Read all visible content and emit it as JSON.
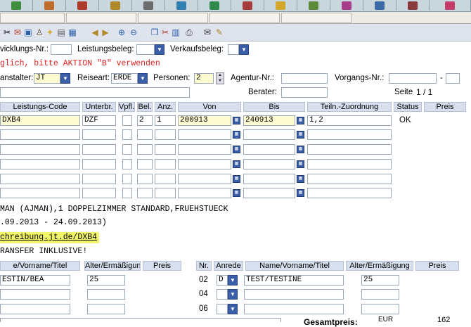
{
  "toolbar": {
    "icons": [
      "printer-icon",
      "mail-icon",
      "save-icon",
      "user-icon",
      "lightbulb-icon",
      "calculator-icon",
      "arrow-left-icon",
      "arrow-right-icon",
      "zoom-in-icon",
      "zoom-out-icon",
      "copy-icon",
      "cut-icon",
      "paste-icon",
      "print-icon",
      "envelope-icon",
      "pen-icon"
    ]
  },
  "form": {
    "abwicklung_label": "vicklungs-Nr.:",
    "leistungsbeleg_label": "Leistungsbeleg:",
    "verkaufsbeleg_label": "Verkaufsbeleg:",
    "message": "glich, bitte AKTION \"B\" verwenden",
    "veranstalter_label": "anstalter:",
    "veranstalter_value": "JT",
    "reiseart_label": "Reiseart:",
    "reiseart_value": "ERDE",
    "personen_label": "Personen:",
    "personen_value": "2",
    "agentur_label": "Agentur-Nr.:",
    "vorgangs_label": "Vorgangs-Nr.:",
    "vorgangs_dash": "-",
    "berater_label": "Berater:",
    "seite_label": "Seite",
    "seite_value": "1 / 1"
  },
  "grid": {
    "headers": [
      "Leistungs-Code",
      "Unterbr.",
      "Vpfl.",
      "Bel.",
      "Anz.",
      "Von",
      "Bis",
      "Teiln.-Zuordnung",
      "Status",
      "Preis"
    ],
    "rows": [
      {
        "code": "DXB4",
        "unterbr": "DZF",
        "vpfl": "",
        "bel": "2",
        "anz": "1",
        "von": "200913",
        "bis": "240913",
        "teiln": "1,2",
        "status": "OK"
      },
      {
        "code": "",
        "unterbr": "",
        "vpfl": "",
        "bel": "",
        "anz": "",
        "von": "",
        "bis": "",
        "teiln": "",
        "status": ""
      },
      {
        "code": "",
        "unterbr": "",
        "vpfl": "",
        "bel": "",
        "anz": "",
        "von": "",
        "bis": "",
        "teiln": "",
        "status": ""
      },
      {
        "code": "",
        "unterbr": "",
        "vpfl": "",
        "bel": "",
        "anz": "",
        "von": "",
        "bis": "",
        "teiln": "",
        "status": ""
      },
      {
        "code": "",
        "unterbr": "",
        "vpfl": "",
        "bel": "",
        "anz": "",
        "von": "",
        "bis": "",
        "teiln": "",
        "status": ""
      },
      {
        "code": "",
        "unterbr": "",
        "vpfl": "",
        "bel": "",
        "anz": "",
        "von": "",
        "bis": "",
        "teiln": "",
        "status": ""
      }
    ]
  },
  "info": {
    "line1": "MAN (AJMAN),1 DOPPELZIMMER STANDARD,FRUEHSTUECK",
    "line2": ".09.2013 - 24.09.2013)",
    "link": "chreibung.jt.de/DXB4",
    "line4": "RANSFER INKLUSIVE!"
  },
  "persons": {
    "left_headers": [
      "e/Vorname/Titel",
      "Alter/Ermäßigung",
      "Preis"
    ],
    "right_headers": [
      "Nr.",
      "Anrede",
      "Name/Vorname/Titel",
      "Alter/Ermäßigung",
      "Preis"
    ],
    "left_rows": [
      {
        "name": "ESTIN/BEA",
        "alter": "25"
      },
      {
        "name": "",
        "alter": ""
      },
      {
        "name": "",
        "alter": ""
      }
    ],
    "right_rows": [
      {
        "nr": "02",
        "anrede": "D",
        "name": "TEST/TESTINE",
        "alter": "25"
      },
      {
        "nr": "04",
        "anrede": "",
        "name": "",
        "alter": ""
      },
      {
        "nr": "06",
        "anrede": "",
        "name": "",
        "alter": ""
      }
    ]
  },
  "footer": {
    "partial_label": "Gesamtpreis:",
    "currency": "EUR",
    "amount": "162"
  }
}
